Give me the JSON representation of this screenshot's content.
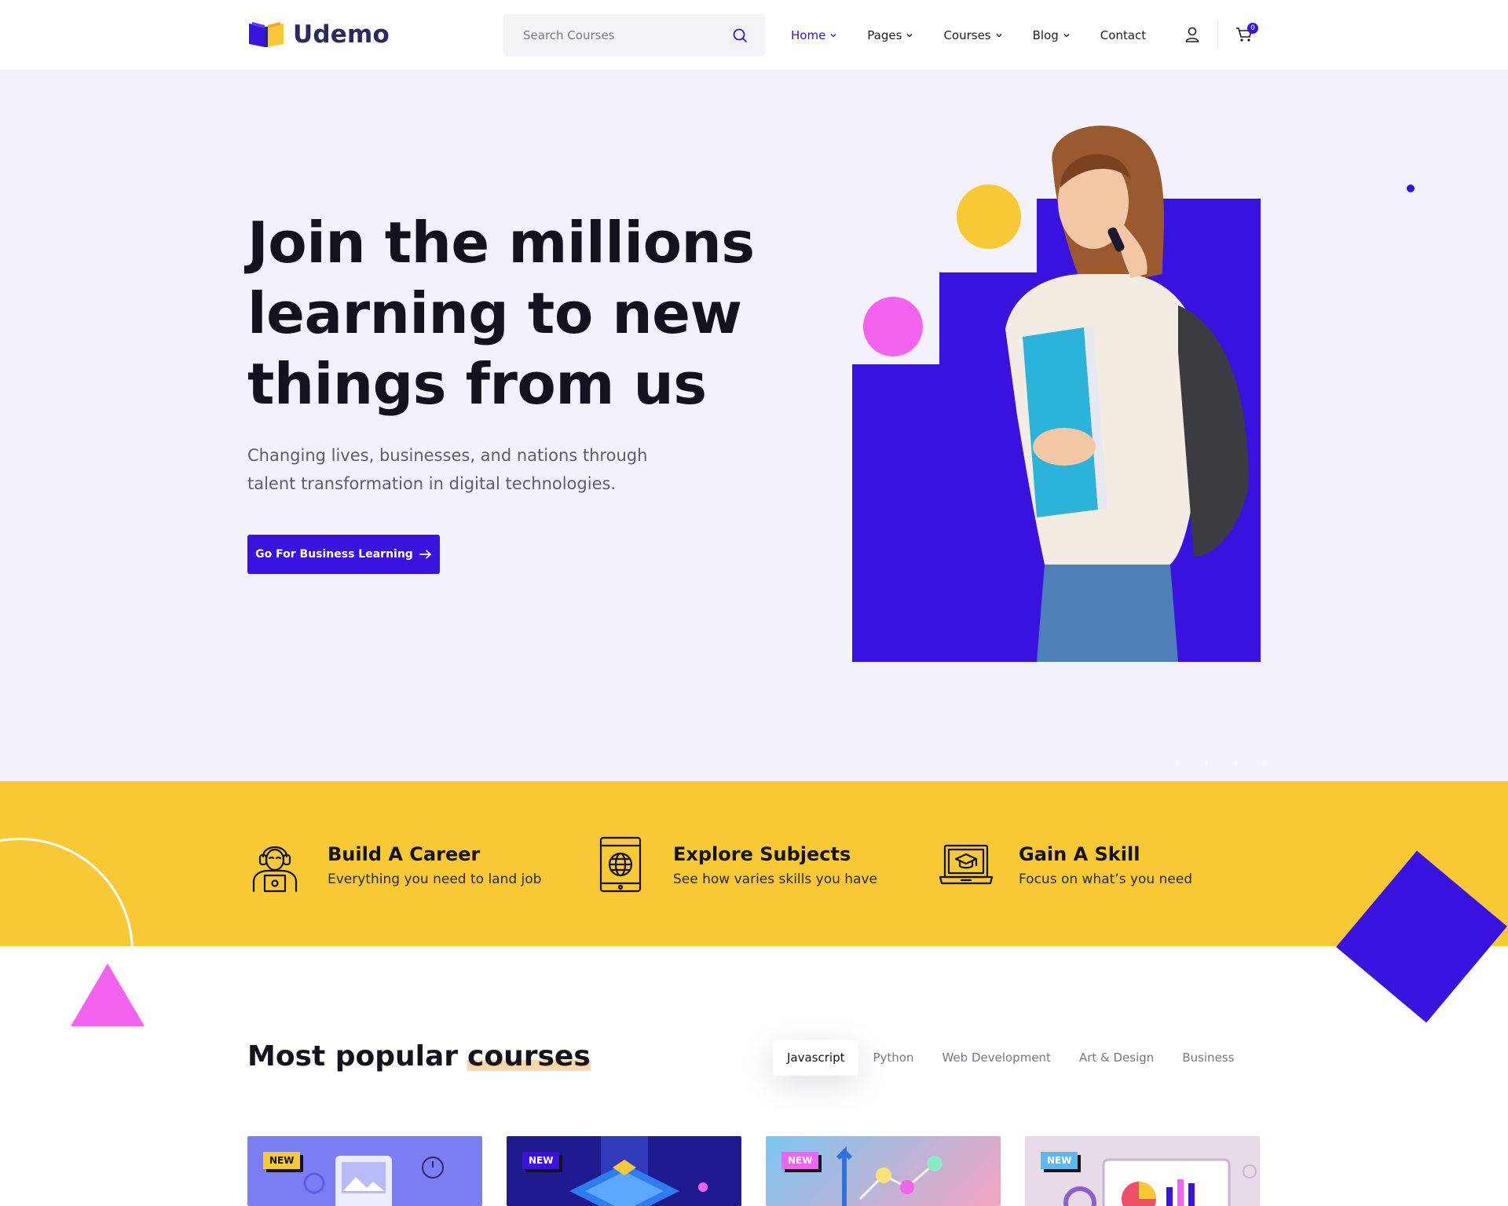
{
  "brand": {
    "name": "Udemo"
  },
  "search": {
    "placeholder": "Search Courses"
  },
  "nav": {
    "items": [
      {
        "label": "Home",
        "dropdown": true,
        "active": true
      },
      {
        "label": "Pages",
        "dropdown": true,
        "active": false
      },
      {
        "label": "Courses",
        "dropdown": true,
        "active": false
      },
      {
        "label": "Blog",
        "dropdown": true,
        "active": false
      },
      {
        "label": "Contact",
        "dropdown": false,
        "active": false
      }
    ],
    "cart_count": "0"
  },
  "hero": {
    "title_lines": [
      "Join the millions",
      "learning to new",
      "things from us"
    ],
    "subtitle_lines": [
      "Changing lives, businesses, and nations through",
      "talent transformation in digital technologies."
    ],
    "cta_label": "Go For Business Learning"
  },
  "features": [
    {
      "title": "Build A Career",
      "desc": "Everything you need to land job",
      "icon": "career-headset-icon"
    },
    {
      "title": "Explore Subjects",
      "desc": "See how varies skills you have",
      "icon": "tablet-globe-icon"
    },
    {
      "title": "Gain A Skill",
      "desc": "Focus on what’s you need",
      "icon": "laptop-graduation-icon"
    }
  ],
  "courses": {
    "title_plain": "Most popular",
    "title_accent": "courses",
    "tabs": [
      "Javascript",
      "Python",
      "Web Development",
      "Art & Design",
      "Business"
    ],
    "active_tab": "Javascript",
    "cards": [
      {
        "badge": "NEW",
        "badge_color": "#f8c935"
      },
      {
        "badge": "NEW",
        "badge_color": "#3a12e0"
      },
      {
        "badge": "NEW",
        "badge_color": "#f462f0"
      },
      {
        "badge": "NEW",
        "badge_color": "#5bb8f0"
      }
    ]
  },
  "colors": {
    "primary": "#3a12e0",
    "yellow": "#f8c935",
    "pink": "#f462f0",
    "hero_bg": "#f2f1fc"
  }
}
